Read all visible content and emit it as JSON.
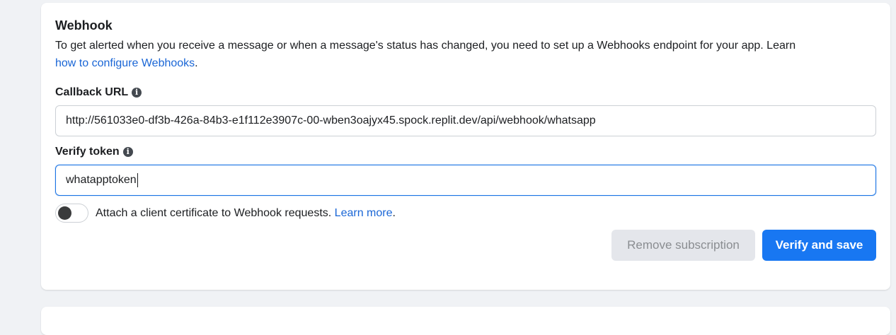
{
  "webhook": {
    "title": "Webhook",
    "description_prefix": "To get alerted when you receive a message or when a message's status has changed, you need to set up a Webhooks endpoint for your app. Learn",
    "description_link": "how to configure Webhooks",
    "description_suffix": "."
  },
  "callback_url": {
    "label": "Callback URL",
    "info_icon": "info-icon",
    "value": "http://561033e0-df3b-426a-84b3-e1f112e3907c-00-wben3oajyx45.spock.replit.dev/api/webhook/whatsapp"
  },
  "verify_token": {
    "label": "Verify token",
    "info_icon": "info-icon",
    "value": "whatapptoken"
  },
  "client_certificate": {
    "text": "Attach a client certificate to Webhook requests.",
    "link": "Learn more",
    "suffix": ".",
    "enabled": false
  },
  "actions": {
    "remove_label": "Remove subscription",
    "verify_label": "Verify and save"
  },
  "colors": {
    "accent": "#1877f2",
    "link": "#1a66d6",
    "disabled_button": "#e4e6eb"
  }
}
